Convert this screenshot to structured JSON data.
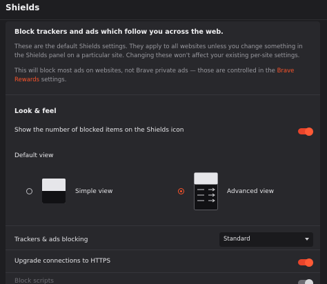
{
  "header": {
    "title": "Shields"
  },
  "intro": {
    "title": "Block trackers and ads which follow you across the web.",
    "desc1": "These are the default Shields settings. They apply to all websites unless you change something in the Shields panel on a particular site. Changing these won't affect your existing per-site settings.",
    "desc2_pre": "This will block most ads on websites, not Brave private ads — those are controlled in the ",
    "desc2_link": "Brave Rewards",
    "desc2_post": " settings."
  },
  "look_feel": {
    "title": "Look & feel",
    "blocked_count_label": "Show the number of blocked items on the Shields icon",
    "blocked_count_on": true,
    "default_view_label": "Default view",
    "simple_view_label": "Simple view",
    "advanced_view_label": "Advanced view",
    "selected_view": "advanced"
  },
  "settings": {
    "trackers_label": "Trackers & ads blocking",
    "trackers_value": "Standard",
    "https_label": "Upgrade connections to HTTPS",
    "https_on": true,
    "cut_label": "Block scripts",
    "cut_on": false
  },
  "colors": {
    "accent": "#fb542b",
    "panel": "#28282c",
    "background": "#1e1e21"
  }
}
